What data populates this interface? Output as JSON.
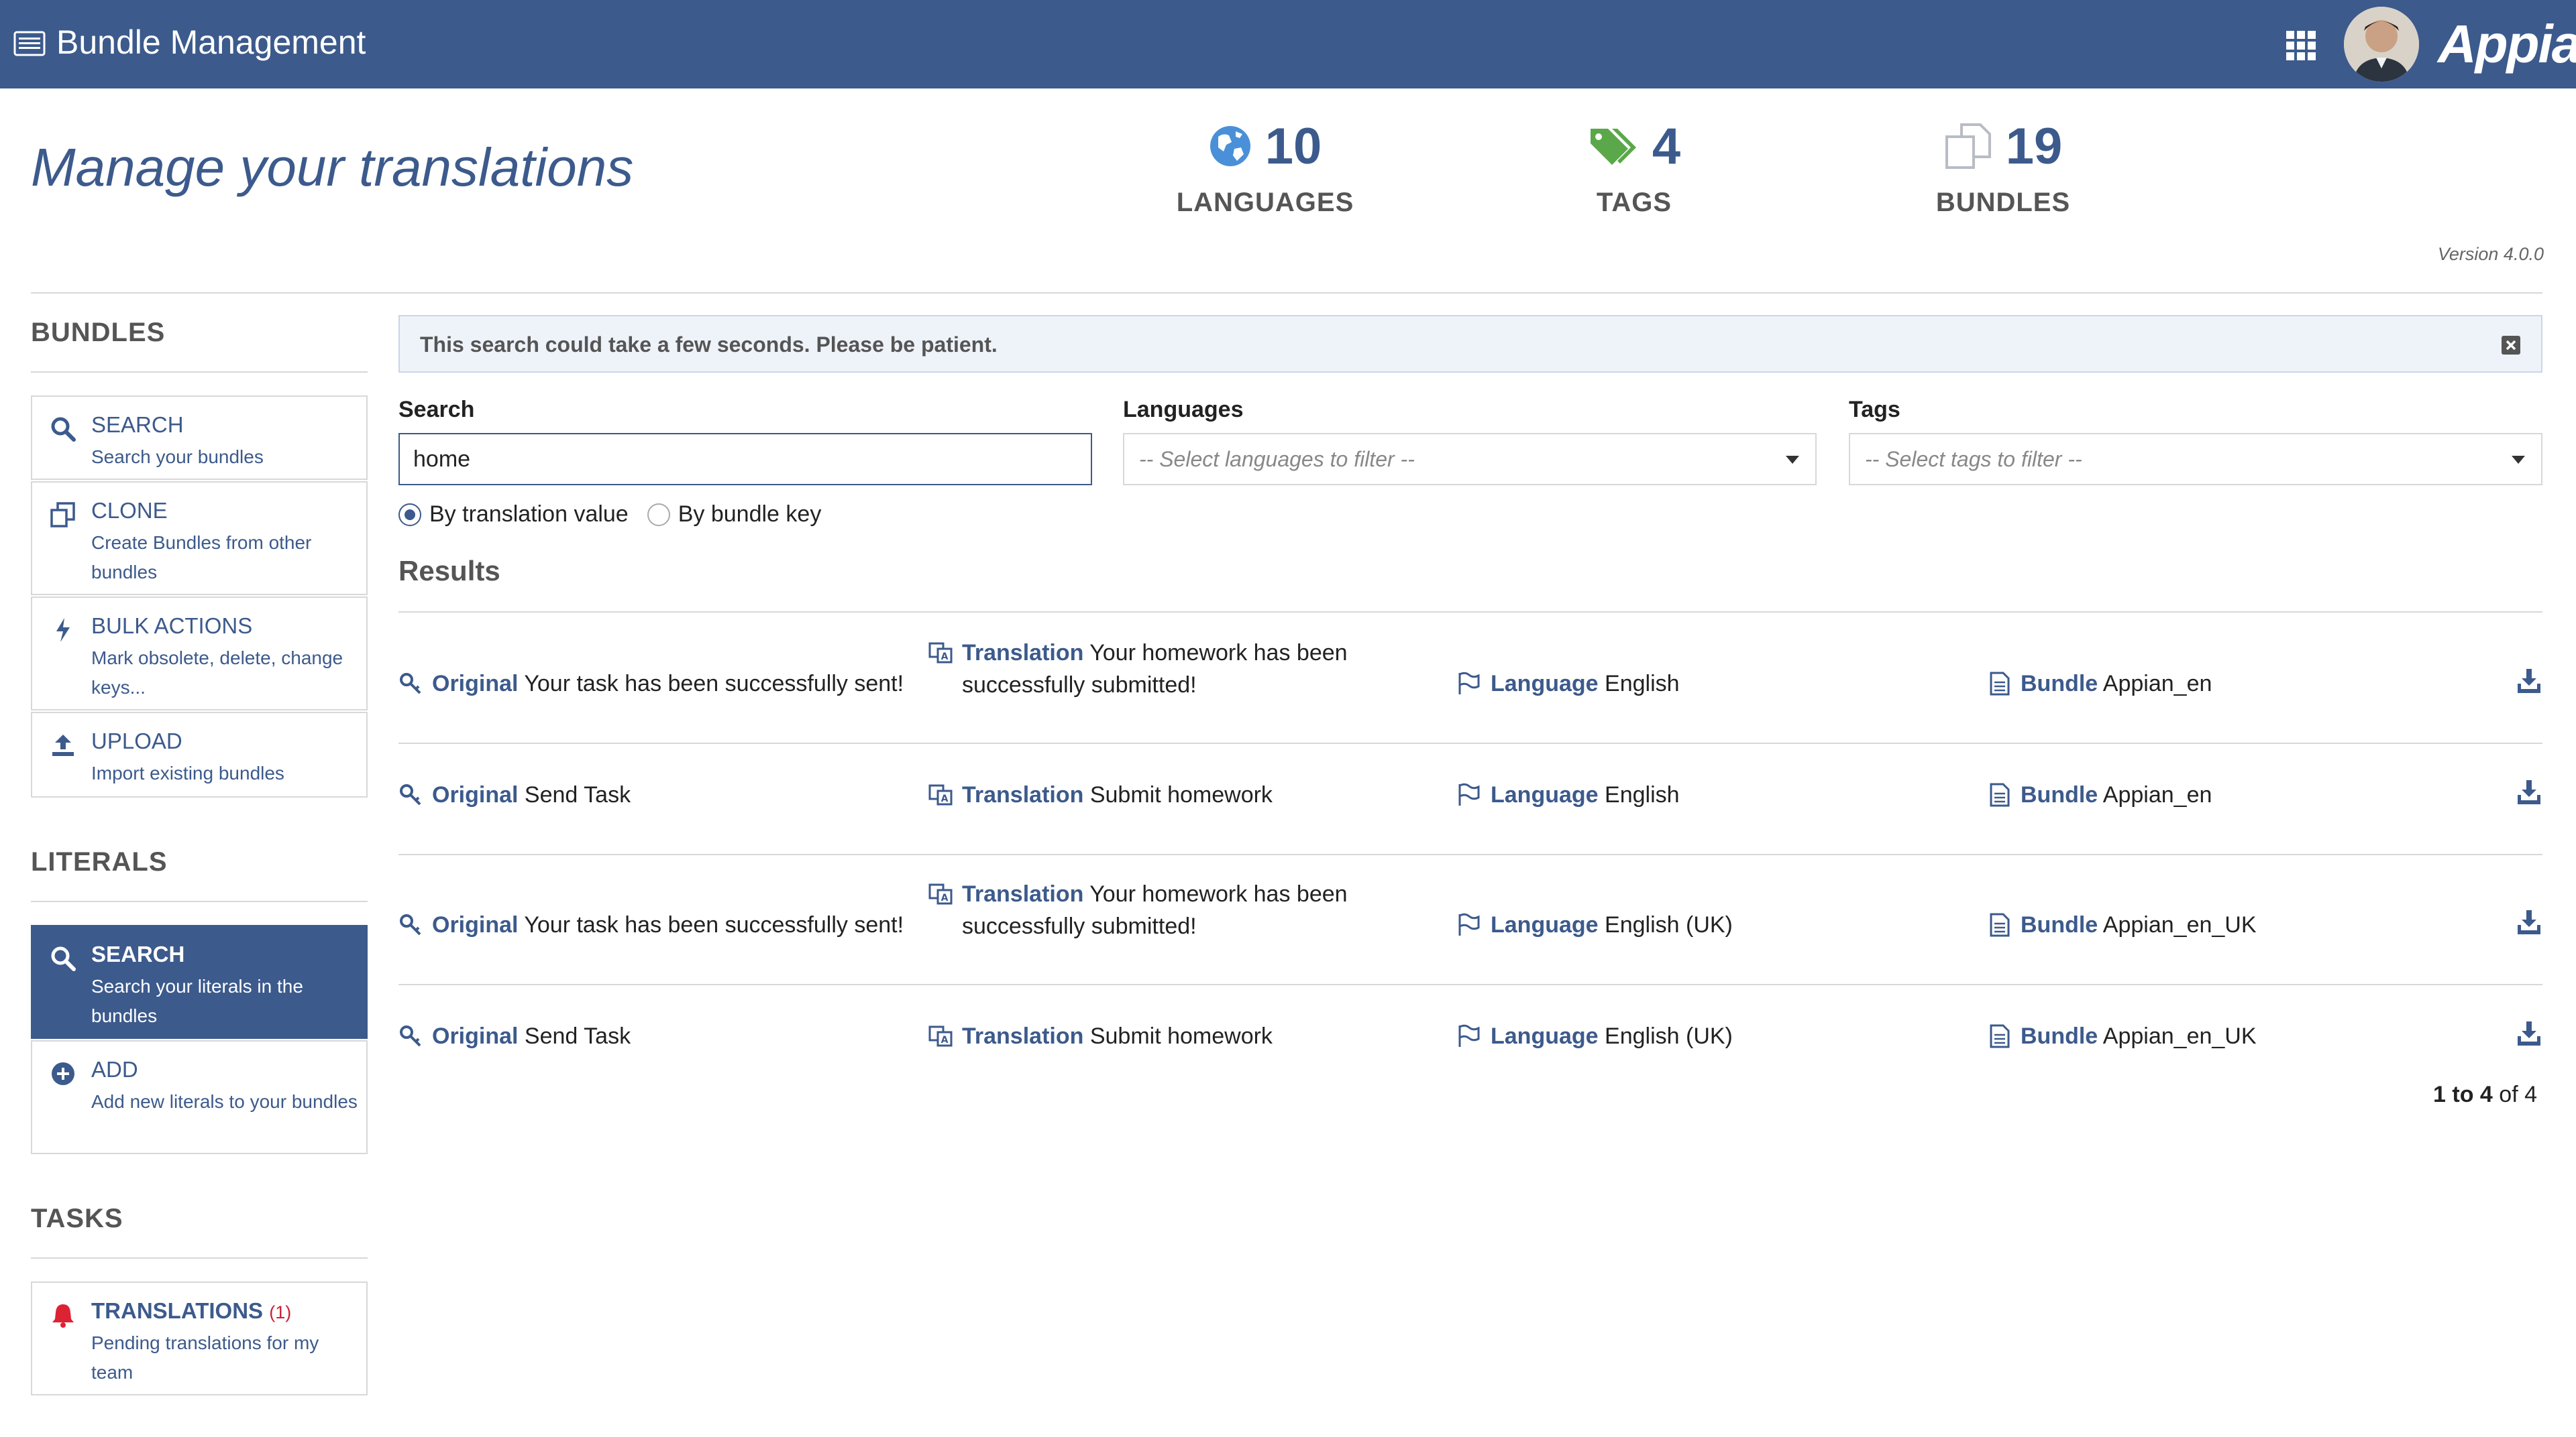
{
  "header": {
    "app_title": "Bundle Management",
    "logo_text": "Appian",
    "accent": "#3c5a8c"
  },
  "hero": {
    "title": "Manage your translations",
    "stats": [
      {
        "value": "10",
        "label": "LANGUAGES",
        "icon": "globe-icon"
      },
      {
        "value": "4",
        "label": "TAGS",
        "icon": "tags-icon"
      },
      {
        "value": "19",
        "label": "BUNDLES",
        "icon": "copy-icon"
      }
    ],
    "version": "Version 4.0.0"
  },
  "sidebar": {
    "bundles_heading": "BUNDLES",
    "bundles": [
      {
        "title": "SEARCH",
        "desc": "Search your bundles",
        "icon": "search-icon"
      },
      {
        "title": "CLONE",
        "desc": "Create Bundles from other bundles",
        "icon": "clone-icon"
      },
      {
        "title": "BULK ACTIONS",
        "desc": "Mark obsolete, delete, change keys...",
        "icon": "bolt-icon"
      },
      {
        "title": "UPLOAD",
        "desc": "Import existing bundles",
        "icon": "upload-icon"
      }
    ],
    "literals_heading": "LITERALS",
    "literals": [
      {
        "title": "SEARCH",
        "desc": "Search your literals in the bundles",
        "icon": "search-icon",
        "active": true
      },
      {
        "title": "ADD",
        "desc": "Add new literals to your bundles",
        "icon": "add-icon"
      }
    ],
    "tasks_heading": "TASKS",
    "tasks": [
      {
        "title": "TRANSLATIONS",
        "count": "(1)",
        "desc": "Pending translations for my team",
        "icon": "bell-icon"
      }
    ]
  },
  "main": {
    "banner": "This search could take a few seconds. Please be patient.",
    "search_label": "Search",
    "search_value": "home",
    "languages_label": "Languages",
    "languages_placeholder": "-- Select languages to filter --",
    "tags_label": "Tags",
    "tags_placeholder": "-- Select tags to filter --",
    "radio": {
      "by_value": "By translation value",
      "by_key": "By bundle key",
      "selected": "by_value"
    },
    "results_title": "Results",
    "labels": {
      "original": "Original",
      "translation": "Translation",
      "language": "Language",
      "bundle": "Bundle"
    },
    "results": [
      {
        "original": "Your task has been successfully sent!",
        "translation": "Your homework has been successfully submitted!",
        "language": "English",
        "bundle": "Appian_en"
      },
      {
        "original": "Send Task",
        "translation": "Submit homework",
        "language": "English",
        "bundle": "Appian_en"
      },
      {
        "original": "Your task has been successfully sent!",
        "translation": "Your homework has been successfully submitted!",
        "language": "English (UK)",
        "bundle": "Appian_en_UK"
      },
      {
        "original": "Send Task",
        "translation": "Submit homework",
        "language": "English (UK)",
        "bundle": "Appian_en_UK"
      }
    ],
    "pager": {
      "range": "1 to 4",
      "total": "of 4"
    }
  }
}
